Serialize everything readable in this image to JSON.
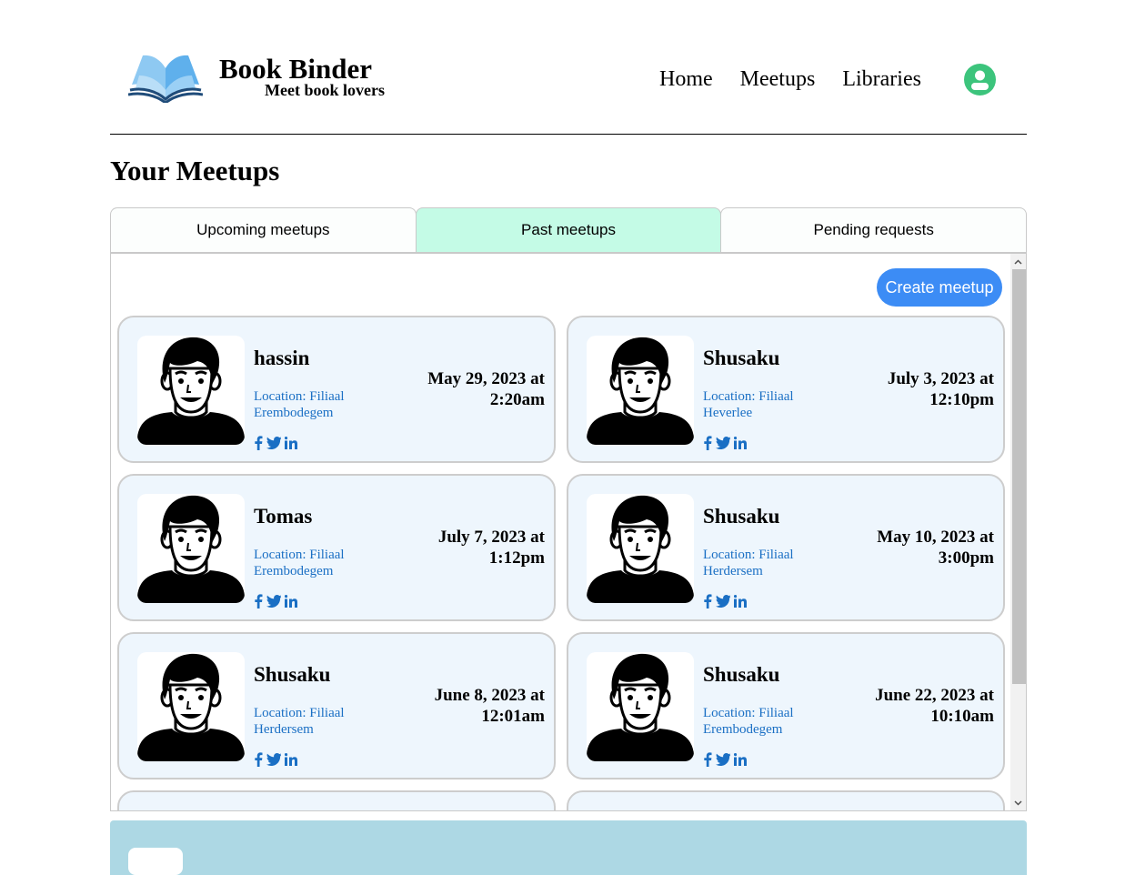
{
  "header": {
    "brand_title": "Book Binder",
    "brand_tagline": "Meet book lovers",
    "nav": [
      "Home",
      "Meetups",
      "Libraries"
    ],
    "logo_icon": "open-book-icon",
    "user_icon": "user-profile-icon"
  },
  "page": {
    "title": "Your Meetups"
  },
  "tabs": [
    {
      "label": "Upcoming meetups",
      "active": false
    },
    {
      "label": "Past meetups",
      "active": true
    },
    {
      "label": "Pending requests",
      "active": false
    }
  ],
  "actions": {
    "create_label": "Create meetup"
  },
  "meetups": [
    {
      "name": "hassin",
      "location": "Location: Filiaal Erembodegem",
      "date": "May 29, 2023 at 2:20am"
    },
    {
      "name": "Shusaku",
      "location": "Location: Filiaal Heverlee",
      "date": "July 3, 2023 at 12:10pm"
    },
    {
      "name": "Tomas",
      "location": "Location: Filiaal Erembodegem",
      "date": "July 7, 2023 at 1:12pm"
    },
    {
      "name": "Shusaku",
      "location": "Location: Filiaal Herdersem",
      "date": "May 10, 2023 at 3:00pm"
    },
    {
      "name": "Shusaku",
      "location": "Location: Filiaal Herdersem",
      "date": "June 8, 2023 at 12:01am"
    },
    {
      "name": "Shusaku",
      "location": "Location: Filiaal Erembodegem",
      "date": "June 22, 2023 at 10:10am"
    }
  ],
  "social_icons": [
    "facebook-icon",
    "twitter-icon",
    "linkedin-icon"
  ],
  "colors": {
    "active_tab": "#c4fbe6",
    "card_background": "#eef6fd",
    "link_blue": "#1a6fc4",
    "button_blue": "#3c8cf5",
    "footer": "#add8e4",
    "user_icon_green": "#3cc47c"
  }
}
